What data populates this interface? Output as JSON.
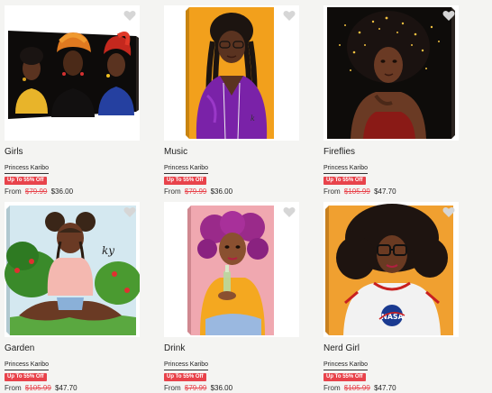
{
  "products": [
    {
      "title": "Girls",
      "artist": "Princess Karibo",
      "badge": "Up To 55% Off",
      "from": "From",
      "old_price": "$79.99",
      "price": "$36.00",
      "image_icon": "three-women-headwrap-canvas"
    },
    {
      "title": "Music",
      "artist": "Princess Karibo",
      "badge": "Up To 55% Off",
      "from": "From",
      "old_price": "$79.99",
      "price": "$36.00",
      "image_icon": "girl-braids-headphones-canvas"
    },
    {
      "title": "Fireflies",
      "artist": "Princess Karibo",
      "badge": "Up To 55% Off",
      "from": "From",
      "old_price": "$105.99",
      "price": "$47.70",
      "image_icon": "woman-afro-fireflies-canvas"
    },
    {
      "title": "Garden",
      "artist": "Princess Karibo",
      "badge": "Up To 55% Off",
      "from": "From",
      "old_price": "$105.99",
      "price": "$47.70",
      "image_icon": "girl-garden-canvas"
    },
    {
      "title": "Drink",
      "artist": "Princess Karibo",
      "badge": "Up To 55% Off",
      "from": "From",
      "old_price": "$79.99",
      "price": "$36.00",
      "image_icon": "girl-pink-hair-drink-canvas"
    },
    {
      "title": "Nerd Girl",
      "artist": "Princess Karibo",
      "badge": "Up To 55% Off",
      "from": "From",
      "old_price": "$105.99",
      "price": "$47.70",
      "image_icon": "nerd-girl-nasa-canvas"
    }
  ],
  "colors": {
    "sale": "#e8434b",
    "background": "#f4f4f2"
  },
  "heart_icon": "heart-icon"
}
